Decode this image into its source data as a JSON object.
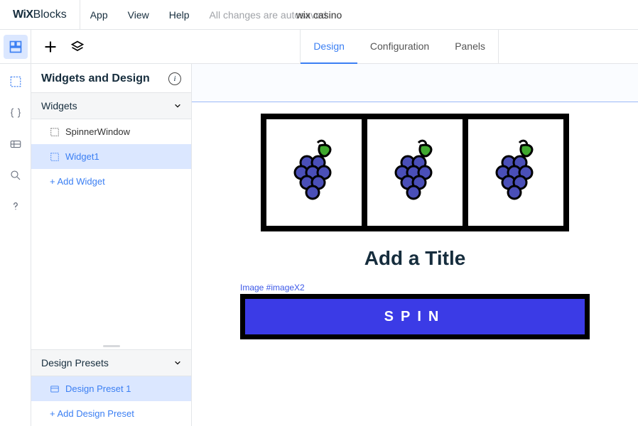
{
  "header": {
    "logo_bold": "WiX",
    "logo_light": "Blocks",
    "menu": [
      "App",
      "View",
      "Help"
    ],
    "autosave": "All changes are autosaved",
    "project": "wix casino"
  },
  "tabs": {
    "design": "Design",
    "configuration": "Configuration",
    "panels": "Panels"
  },
  "sidepanel": {
    "title": "Widgets and Design",
    "widgets_label": "Widgets",
    "widgets": {
      "item0": "SpinnerWindow",
      "item1": "Widget1"
    },
    "add_widget": "+ Add Widget",
    "presets_label": "Design Presets",
    "presets": {
      "item0": "Design Preset 1"
    },
    "add_preset": "+ Add Design Preset"
  },
  "canvas": {
    "title": "Add a Title",
    "selection_label": "Image #imageX2",
    "spin_label": "SPIN"
  }
}
